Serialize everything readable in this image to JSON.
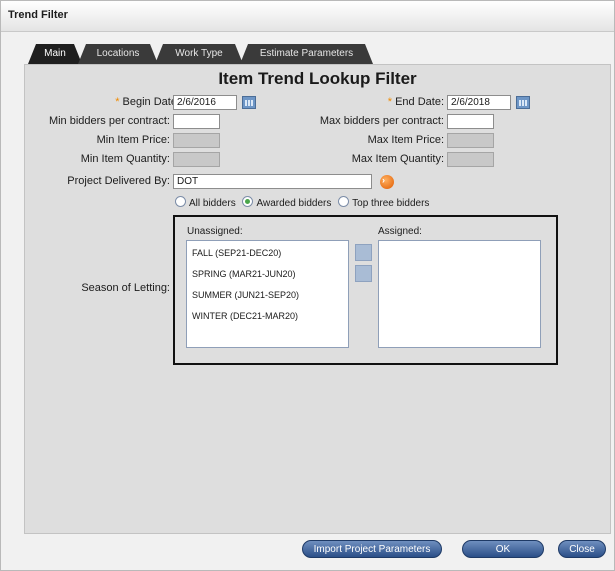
{
  "window": {
    "title": "Trend Filter"
  },
  "tabs": [
    {
      "label": "Main",
      "active": true
    },
    {
      "label": "Locations",
      "active": false
    },
    {
      "label": "Work Type",
      "active": false
    },
    {
      "label": "Estimate Parameters",
      "active": false
    }
  ],
  "form": {
    "heading": "Item Trend Lookup Filter",
    "begin_date": {
      "label": "Begin Date:",
      "value": "2/6/2016",
      "required": true
    },
    "end_date": {
      "label": "End Date:",
      "value": "2/6/2018",
      "required": true
    },
    "min_bidders": {
      "label": "Min bidders per contract:",
      "value": ""
    },
    "max_bidders": {
      "label": "Max bidders per contract:",
      "value": ""
    },
    "min_item_price": {
      "label": "Min Item Price:",
      "value": ""
    },
    "max_item_price": {
      "label": "Max Item Price:",
      "value": ""
    },
    "min_item_quantity": {
      "label": "Min Item Quantity:",
      "value": ""
    },
    "max_item_quantity": {
      "label": "Max Item Quantity:",
      "value": ""
    },
    "project_delivered_by": {
      "label": "Project Delivered By:",
      "value": "DOT"
    },
    "bidders_options": [
      {
        "label": "All bidders",
        "selected": false
      },
      {
        "label": "Awarded bidders",
        "selected": true
      },
      {
        "label": "Top three bidders",
        "selected": false
      }
    ],
    "season": {
      "label": "Season of Letting:",
      "unassigned_label": "Unassigned:",
      "assigned_label": "Assigned:",
      "unassigned_items": [
        "FALL (SEP21-DEC20)",
        "SPRING (MAR21-JUN20)",
        "SUMMER (JUN21-SEP20)",
        "WINTER (DEC21-MAR20)"
      ],
      "assigned_items": []
    }
  },
  "buttons": {
    "import": "Import Project Parameters",
    "ok": "OK",
    "close": "Close"
  },
  "colors": {
    "required": "#f08a00",
    "button": "#2b4f88",
    "tab_active": "#1f1f1f"
  },
  "icons": {
    "date_picker": "calendar-icon",
    "lookup": "go-arrow-icon",
    "move": "move-arrow-icon"
  }
}
